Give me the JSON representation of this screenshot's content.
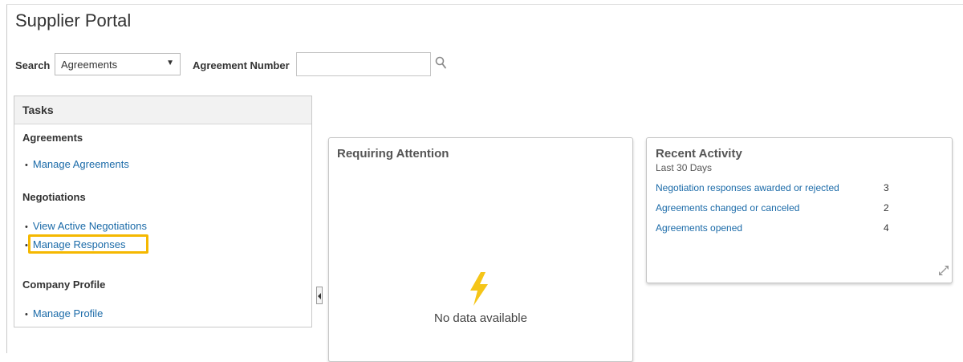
{
  "page": {
    "title": "Supplier Portal"
  },
  "search": {
    "label": "Search",
    "selected": "Agreements",
    "caret": "▼",
    "agreement_label": "Agreement Number",
    "agreement_value": ""
  },
  "tasks": {
    "header": "Tasks",
    "sections": [
      {
        "title": "Agreements",
        "links": [
          "Manage Agreements"
        ]
      },
      {
        "title": "Negotiations",
        "links": [
          "View Active Negotiations",
          "Manage Responses"
        ]
      },
      {
        "title": "Company Profile",
        "links": [
          "Manage Profile"
        ]
      }
    ],
    "bullet": "•",
    "highlighted_link": "Manage Responses",
    "highlight_color": "#f5b800"
  },
  "requiring": {
    "title": "Requiring Attention",
    "empty_text": "No data available",
    "icon": "lightning-bolt-icon",
    "icon_color": "#f5c518"
  },
  "recent": {
    "title": "Recent Activity",
    "subtitle": "Last 30 Days",
    "items": [
      {
        "label": "Negotiation responses awarded or rejected",
        "count": "3"
      },
      {
        "label": "Agreements changed or canceled",
        "count": "2"
      },
      {
        "label": "Agreements opened",
        "count": "4"
      }
    ]
  },
  "colors": {
    "link": "#1a6aa8",
    "text": "#333333"
  }
}
